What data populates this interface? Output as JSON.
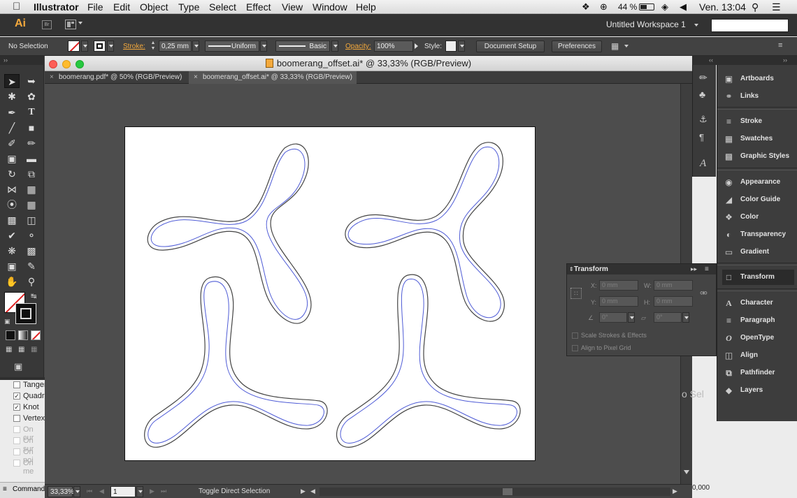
{
  "menubar": {
    "apple_icon": "apple-logo",
    "app_name": "Illustrator",
    "items": [
      "File",
      "Edit",
      "Object",
      "Type",
      "Select",
      "Effect",
      "View",
      "Window",
      "Help"
    ],
    "battery": "44 %",
    "clock": "Ven. 13:04"
  },
  "appbar": {
    "logo": "Ai",
    "bridge": "Br",
    "workspace": "Untitled Workspace 1"
  },
  "control": {
    "selection": "No Selection",
    "stroke_label": "Stroke:",
    "stroke_weight": "0,25 mm",
    "profile_uniform": "Uniform",
    "brush_basic": "Basic",
    "opacity_label": "Opacity:",
    "opacity_value": "100%",
    "style_label": "Style:",
    "doc_setup": "Document Setup",
    "preferences": "Preferences"
  },
  "document": {
    "window_title": "boomerang_offset.ai* @ 33,33% (RGB/Preview)",
    "tabs": [
      {
        "label": "boomerang.pdf* @ 50% (RGB/Preview)",
        "active": false
      },
      {
        "label": "boomerang_offset.ai* @ 33,33% (RGB/Preview)",
        "active": true
      }
    ],
    "zoom": "33,33%",
    "page": "1",
    "status_text": "Toggle Direct Selection"
  },
  "colors": {
    "accent_orange": "#f4a93c",
    "offset_path": "#4e5bd6",
    "outline_path": "#444444",
    "fill_none_slash": "#e02020"
  },
  "left_panel": {
    "items": [
      {
        "label": "Tanger",
        "checked": false,
        "enabled": true
      },
      {
        "label": "Quadra",
        "checked": true,
        "enabled": true
      },
      {
        "label": "Knot",
        "checked": true,
        "enabled": true
      },
      {
        "label": "Vertex",
        "checked": false,
        "enabled": true
      },
      {
        "label": "On cur",
        "checked": false,
        "enabled": false
      },
      {
        "label": "On sur",
        "checked": false,
        "enabled": false
      },
      {
        "label": "On poi",
        "checked": false,
        "enabled": false
      },
      {
        "label": "On me",
        "checked": false,
        "enabled": false
      }
    ],
    "command": "Command"
  },
  "dock": {
    "items": [
      "Artboards",
      "Links",
      "Stroke",
      "Swatches",
      "Graphic Styles",
      "Appearance",
      "Color Guide",
      "Color",
      "Transparency",
      "Gradient",
      "Transform",
      "Character",
      "Paragraph",
      "OpenType",
      "Align",
      "Pathfinder",
      "Layers"
    ],
    "active": "Transform"
  },
  "transform_panel": {
    "title": "Transform",
    "x_label": "X:",
    "y_label": "Y:",
    "w_label": "W:",
    "h_label": "H:",
    "x": "0 mm",
    "y": "0 mm",
    "w": "0 mm",
    "h": "0 mm",
    "angle": "0°",
    "shear": "0°",
    "scale_strokes": "Scale Strokes & Effects",
    "align_pixel": "Align to Pixel Grid"
  },
  "right_fragments": {
    "partial_text": "o Sel",
    "partial_coord": "0,000"
  }
}
